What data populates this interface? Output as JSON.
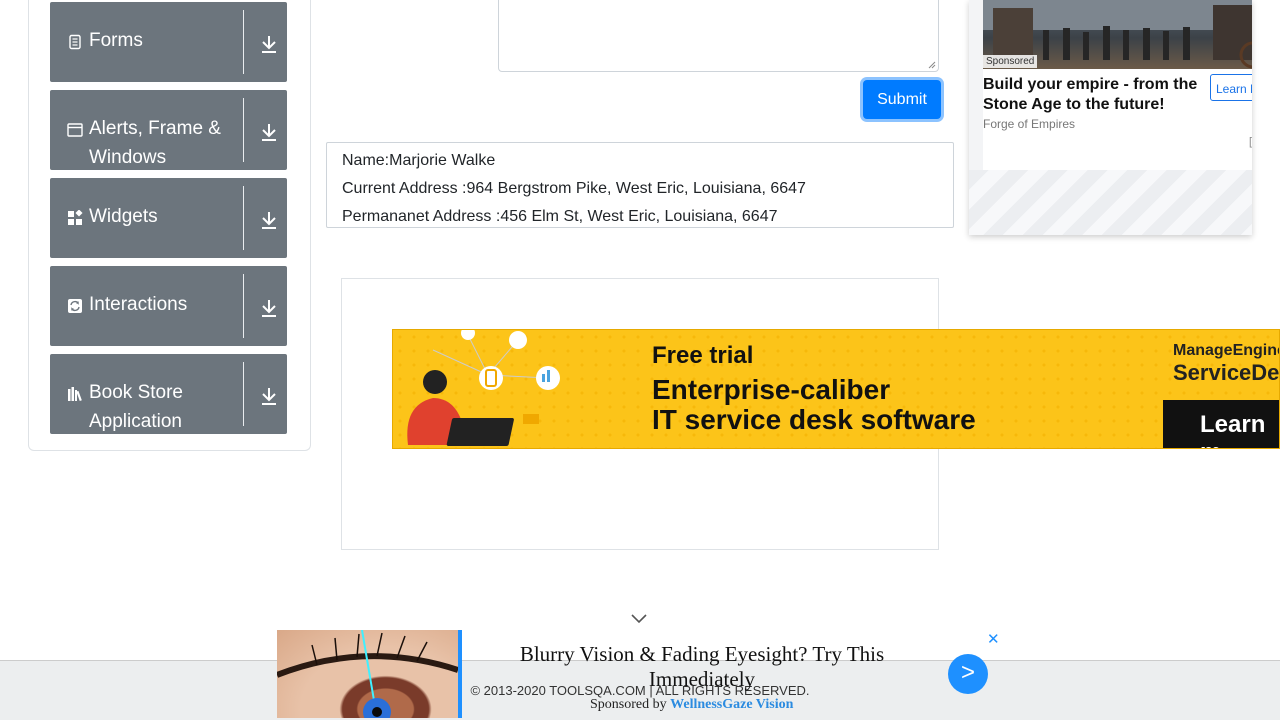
{
  "sidebar": {
    "groups": [
      {
        "label": "Forms",
        "icon": "form-icon"
      },
      {
        "label": "Alerts, Frame & Windows",
        "icon": "window-icon"
      },
      {
        "label": "Widgets",
        "icon": "widgets-icon"
      },
      {
        "label": "Interactions",
        "icon": "interactions-icon"
      },
      {
        "label": "Book Store Application",
        "icon": "books-icon"
      }
    ]
  },
  "form": {
    "submit_label": "Submit"
  },
  "output": {
    "name": "Name:Marjorie Walke",
    "current_address": "Current Address :964 Bergstrom Pike, West Eric, Louisiana, 6647",
    "permanent_address": "Permananet Address :456 Elm St, West Eric, Louisiana, 6647"
  },
  "banner_ad": {
    "line1": "Free trial",
    "line2": "Enterprise-caliber",
    "line3": "IT service desk software",
    "brand_top": "ManageEngine",
    "brand_bottom": "ServiceDe",
    "cta": "Learn m"
  },
  "right_ad": {
    "sponsored": "Sponsored",
    "headline": "Build your empire - from the Stone Age to the future!",
    "source": "Forge of Empires",
    "cta": "Learn More",
    "adchoice": "[?]"
  },
  "footer": {
    "copyright": "© 2013-2020 TOOLSQA.COM | ALL RIGHTS RESERVED."
  },
  "bottom_ad": {
    "title": "Blurry Vision & Fading Eyesight? Try This Immediately",
    "sponsored_prefix": "Sponsored by ",
    "sponsor": "WellnessGaze Vision",
    "go": ">",
    "close": "✕"
  },
  "colors": {
    "sidebar_group": "#6c757d",
    "primary": "#007bff",
    "banner_yellow": "#fcc419"
  }
}
